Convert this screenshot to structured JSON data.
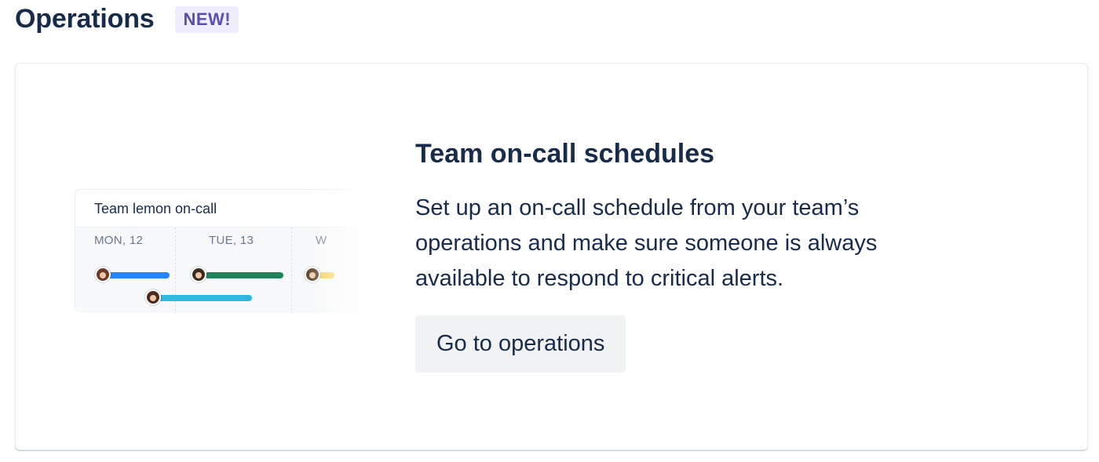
{
  "header": {
    "title": "Operations",
    "badge": "NEW!"
  },
  "card": {
    "illustration": {
      "title": "Team lemon on-call",
      "days": [
        "MON, 12",
        "TUE, 13",
        "W"
      ],
      "bar_colors": {
        "blue": "#2684ff",
        "green": "#1f845a",
        "teal": "#2eb8e0",
        "yellow": "#f5cd47"
      }
    },
    "title": "Team on-call schedules",
    "description": "Set up an on-call schedule from your team’s operations and make sure someone is always available to respond to critical alerts.",
    "button_label": "Go to operations"
  }
}
